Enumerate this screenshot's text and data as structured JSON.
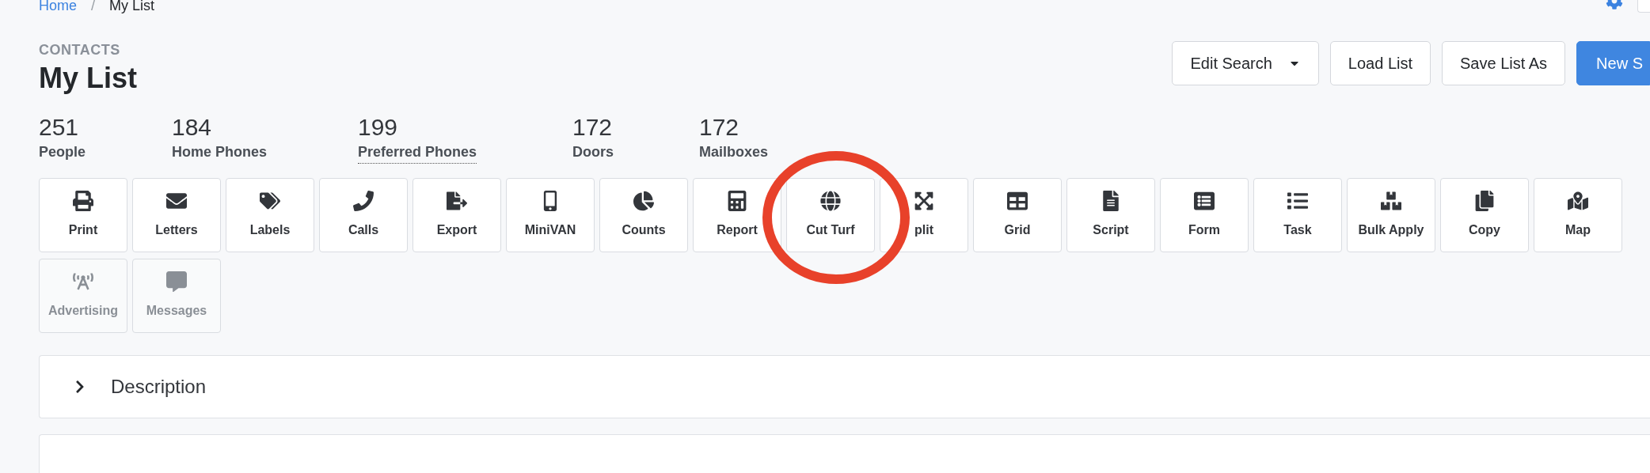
{
  "breadcrumb": {
    "items": [
      "Home",
      "My List"
    ],
    "separator": "/"
  },
  "header": {
    "section": "CONTACTS",
    "title": "My List"
  },
  "actions": [
    {
      "label": "Edit Search",
      "kind": "dropdown"
    },
    {
      "label": "Load List",
      "kind": "plain"
    },
    {
      "label": "Save List As",
      "kind": "plain"
    },
    {
      "label": "New S",
      "kind": "primary"
    }
  ],
  "stats": [
    {
      "value": "251",
      "label": "People",
      "underlined": false
    },
    {
      "value": "184",
      "label": "Home Phones",
      "underlined": false
    },
    {
      "value": "199",
      "label": "Preferred Phones",
      "underlined": true
    },
    {
      "value": "172",
      "label": "Doors",
      "underlined": false
    },
    {
      "value": "172",
      "label": "Mailboxes",
      "underlined": false
    }
  ],
  "tools": [
    {
      "label": "Print",
      "disabled": false
    },
    {
      "label": "Letters",
      "disabled": false
    },
    {
      "label": "Labels",
      "disabled": false
    },
    {
      "label": "Calls",
      "disabled": false
    },
    {
      "label": "Export",
      "disabled": false
    },
    {
      "label": "MiniVAN",
      "disabled": false
    },
    {
      "label": "Counts",
      "disabled": false
    },
    {
      "label": "Report",
      "disabled": false
    },
    {
      "label": "Cut Turf",
      "disabled": false
    },
    {
      "label": "plit",
      "disabled": false
    },
    {
      "label": "Grid",
      "disabled": false
    },
    {
      "label": "Script",
      "disabled": false
    },
    {
      "label": "Form",
      "disabled": false
    },
    {
      "label": "Task",
      "disabled": false
    },
    {
      "label": "Bulk Apply",
      "disabled": false
    },
    {
      "label": "Copy",
      "disabled": false
    },
    {
      "label": "Map",
      "disabled": false
    },
    {
      "label": "Advertising",
      "disabled": true
    },
    {
      "label": "Messages",
      "disabled": true
    }
  ],
  "panels": [
    {
      "title": "Description",
      "expanded": false
    }
  ]
}
